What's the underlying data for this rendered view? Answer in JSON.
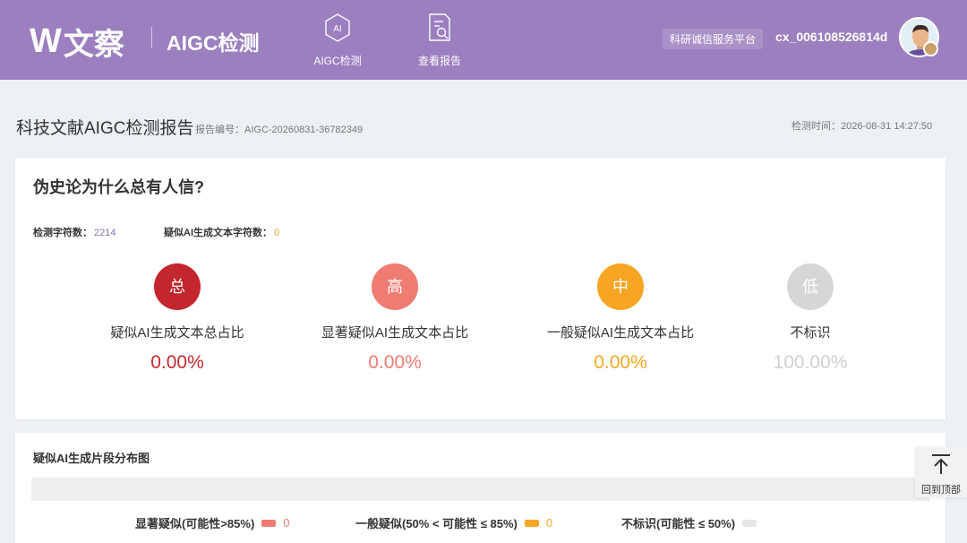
{
  "header": {
    "logo_mark": "W",
    "logo_text": "文察",
    "brand": "AIGC检测",
    "nav": [
      {
        "label": "AIGC检测",
        "icon": "ai-chip-icon"
      },
      {
        "label": "查看报告",
        "icon": "report-search-icon"
      }
    ],
    "platform": "科研诚信服务平台",
    "username": "cx_006108526814d",
    "avatar_icon": "user-avatar",
    "power_icon": "power-icon"
  },
  "report": {
    "title": "科技文献AIGC检测报告",
    "number": "报告编号：AIGC-20260831-36782349",
    "time": "检测时间：2026-08-31 14:27:50"
  },
  "summary": {
    "doc_title": "伪史论为什么总有人信?",
    "char_count_label": "检测字符数：",
    "char_count": "2214",
    "ai_char_label": "疑似AI生成文本字符数：",
    "ai_char_count": "0",
    "metrics": [
      {
        "badge": "总",
        "label": "疑似AI生成文本总占比",
        "value": "0.00%",
        "color": "#c2272d"
      },
      {
        "badge": "高",
        "label": "显著疑似AI生成文本占比",
        "value": "0.00%",
        "color": "#ef7c72"
      },
      {
        "badge": "中",
        "label": "一般疑似AI生成文本占比",
        "value": "0.00%",
        "color": "#f6a623"
      },
      {
        "badge": "低",
        "label": "不标识",
        "value": "100.00%",
        "color": "#d6d6d6"
      }
    ]
  },
  "distribution": {
    "title": "疑似AI生成片段分布图",
    "legend": [
      {
        "label": "显著疑似(可能性>85%)",
        "count": "0",
        "color": "#ef7c72"
      },
      {
        "label": "一般疑似(50% < 可能性 ≤ 85%)",
        "count": "0",
        "color": "#f6a623"
      },
      {
        "label": "不标识(可能性 ≤ 50%)",
        "color": "#e6e6e6"
      }
    ]
  },
  "back_to_top": "回到顶部"
}
